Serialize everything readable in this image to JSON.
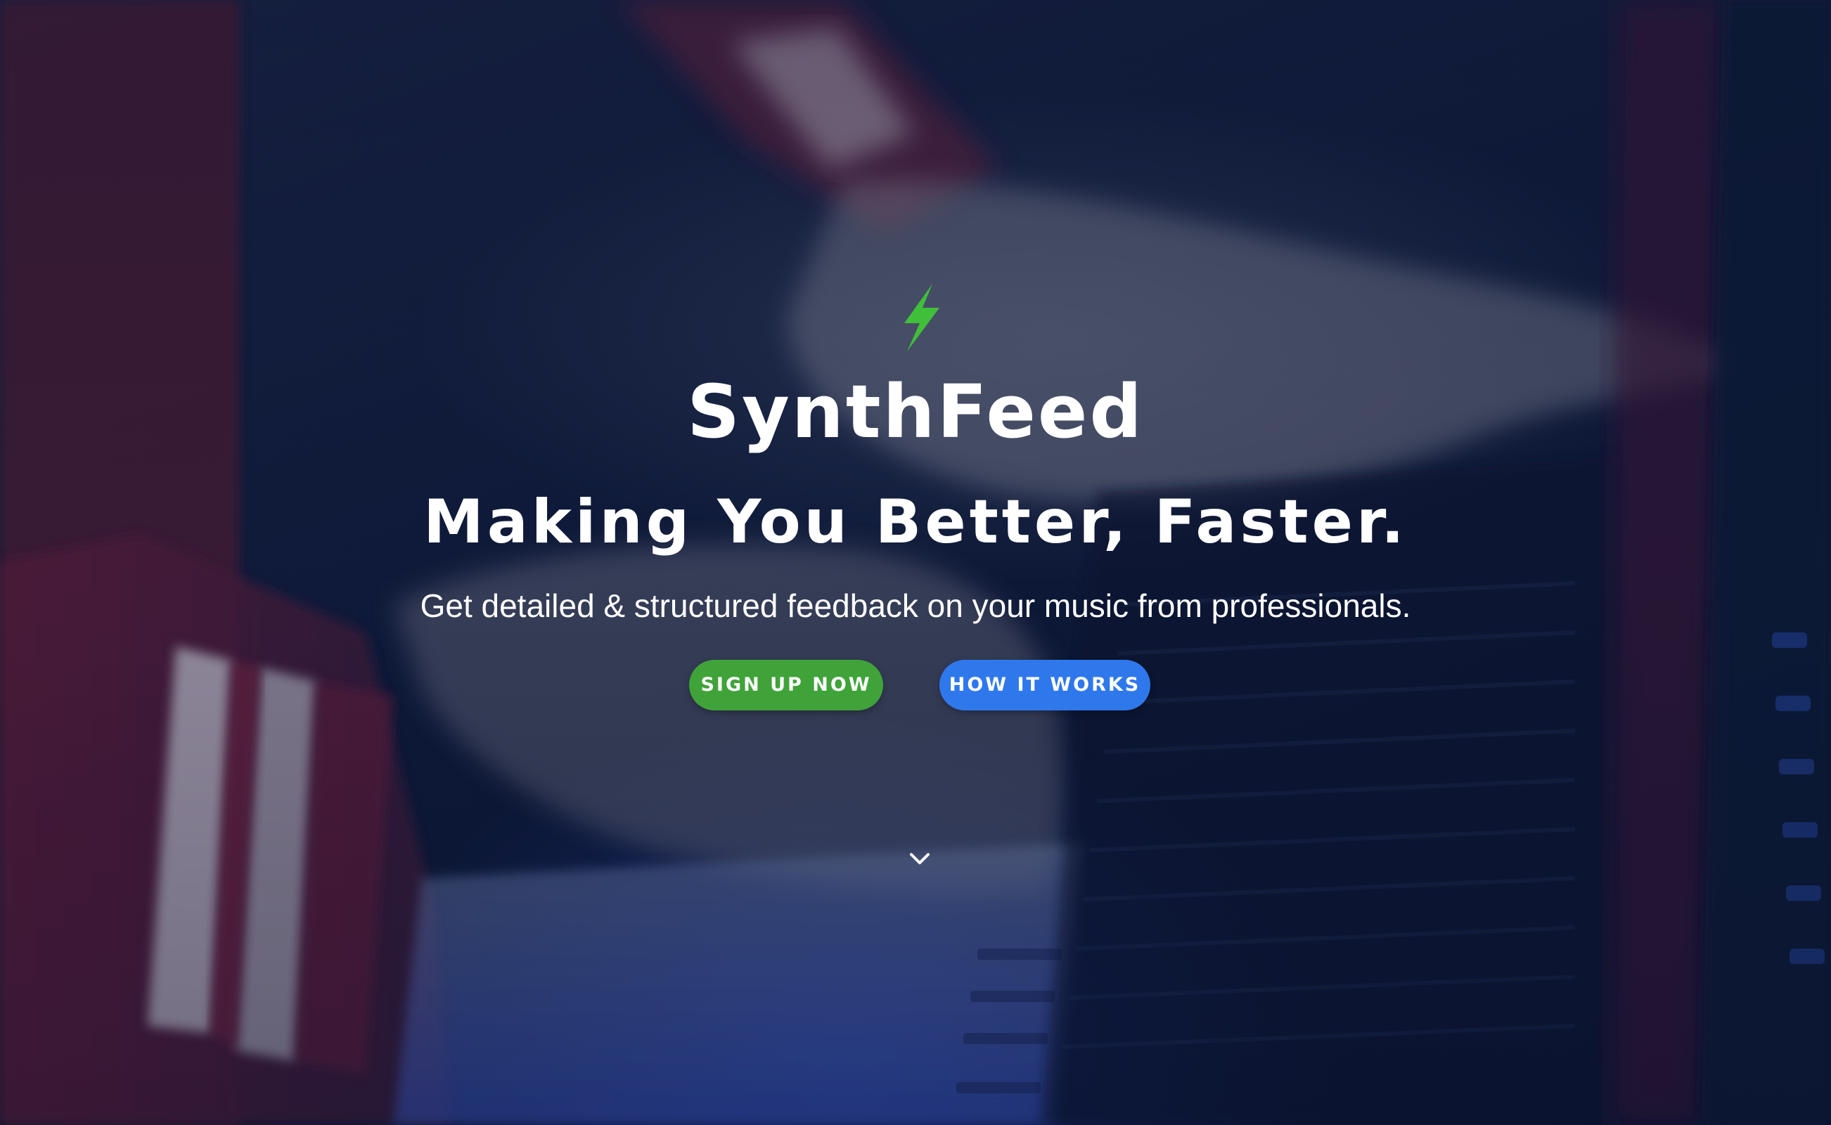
{
  "brand": {
    "logo_icon": "lightning-bolt-icon",
    "name": "SynthFeed"
  },
  "hero": {
    "headline": "Making You Better, Faster.",
    "subheadline": "Get detailed & structured feedback on your music from professionals.",
    "cta_primary": "SIGN UP NOW",
    "cta_secondary": "HOW IT WORKS",
    "scroll_icon": "chevron-down-icon"
  },
  "colors": {
    "accent_green": "#3fa33a",
    "accent_blue": "#2f78ec",
    "text": "#ffffff",
    "background": "#0f1b3b"
  }
}
